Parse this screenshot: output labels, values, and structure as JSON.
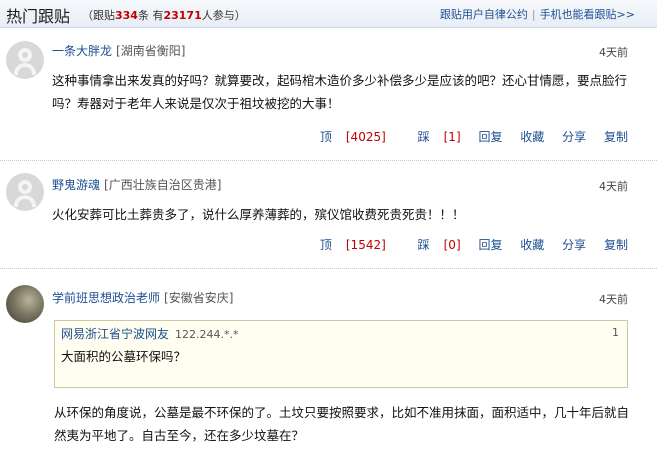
{
  "header": {
    "title": "热门跟贴",
    "stats_prefix": "（跟贴",
    "reply_count": "334",
    "stats_mid": "条  有",
    "participant_count": "23171",
    "stats_suffix": "人参与）",
    "link_convention": "跟贴用户自律公约",
    "separator": "|",
    "link_mobile": "手机也能看跟贴>>"
  },
  "posts": [
    {
      "username": "一条大胖龙",
      "location": "[湖南省衡阳]",
      "time": "4天前",
      "avatar": "default-avatar",
      "content": "这种事情拿出来发真的好吗？就算要改，起码棺木造价多少补偿多少是应该的吧？还心甘情愿，要点脸行吗？寿器对于老年人来说是仅次于祖坟被挖的大事！",
      "upvote_label": "顶",
      "upvote_count": "[4025]",
      "downvote_label": "踩",
      "downvote_count": "[1]",
      "reply_label": "回复",
      "collect_label": "收藏",
      "share_label": "分享",
      "copy_label": "复制"
    },
    {
      "username": "野鬼游魂",
      "location": "[广西壮族自治区贵港]",
      "time": "4天前",
      "avatar": "default-avatar",
      "content": "火化安葬可比土葬贵多了，说什么厚养薄葬的，殡仪馆收费死贵死贵！！！",
      "upvote_label": "顶",
      "upvote_count": "[1542]",
      "downvote_label": "踩",
      "downvote_count": "[0]",
      "reply_label": "回复",
      "collect_label": "收藏",
      "share_label": "分享",
      "copy_label": "复制"
    },
    {
      "username": "学前班思想政治老师",
      "location": "[安徽省安庆]",
      "time": "4天前",
      "avatar": "photo-avatar",
      "quote": {
        "username": "网易浙江省宁波网友",
        "ip": "122.244.*.*",
        "floor": "1",
        "text": "大面积的公墓环保吗？"
      },
      "content": "从环保的角度说，公墓是最不环保的了。土坟只要按照要求，比如不准用抹面，面积适中，几十年后就自然夷为平地了。自古至今，还在多少坟墓在？"
    }
  ]
}
